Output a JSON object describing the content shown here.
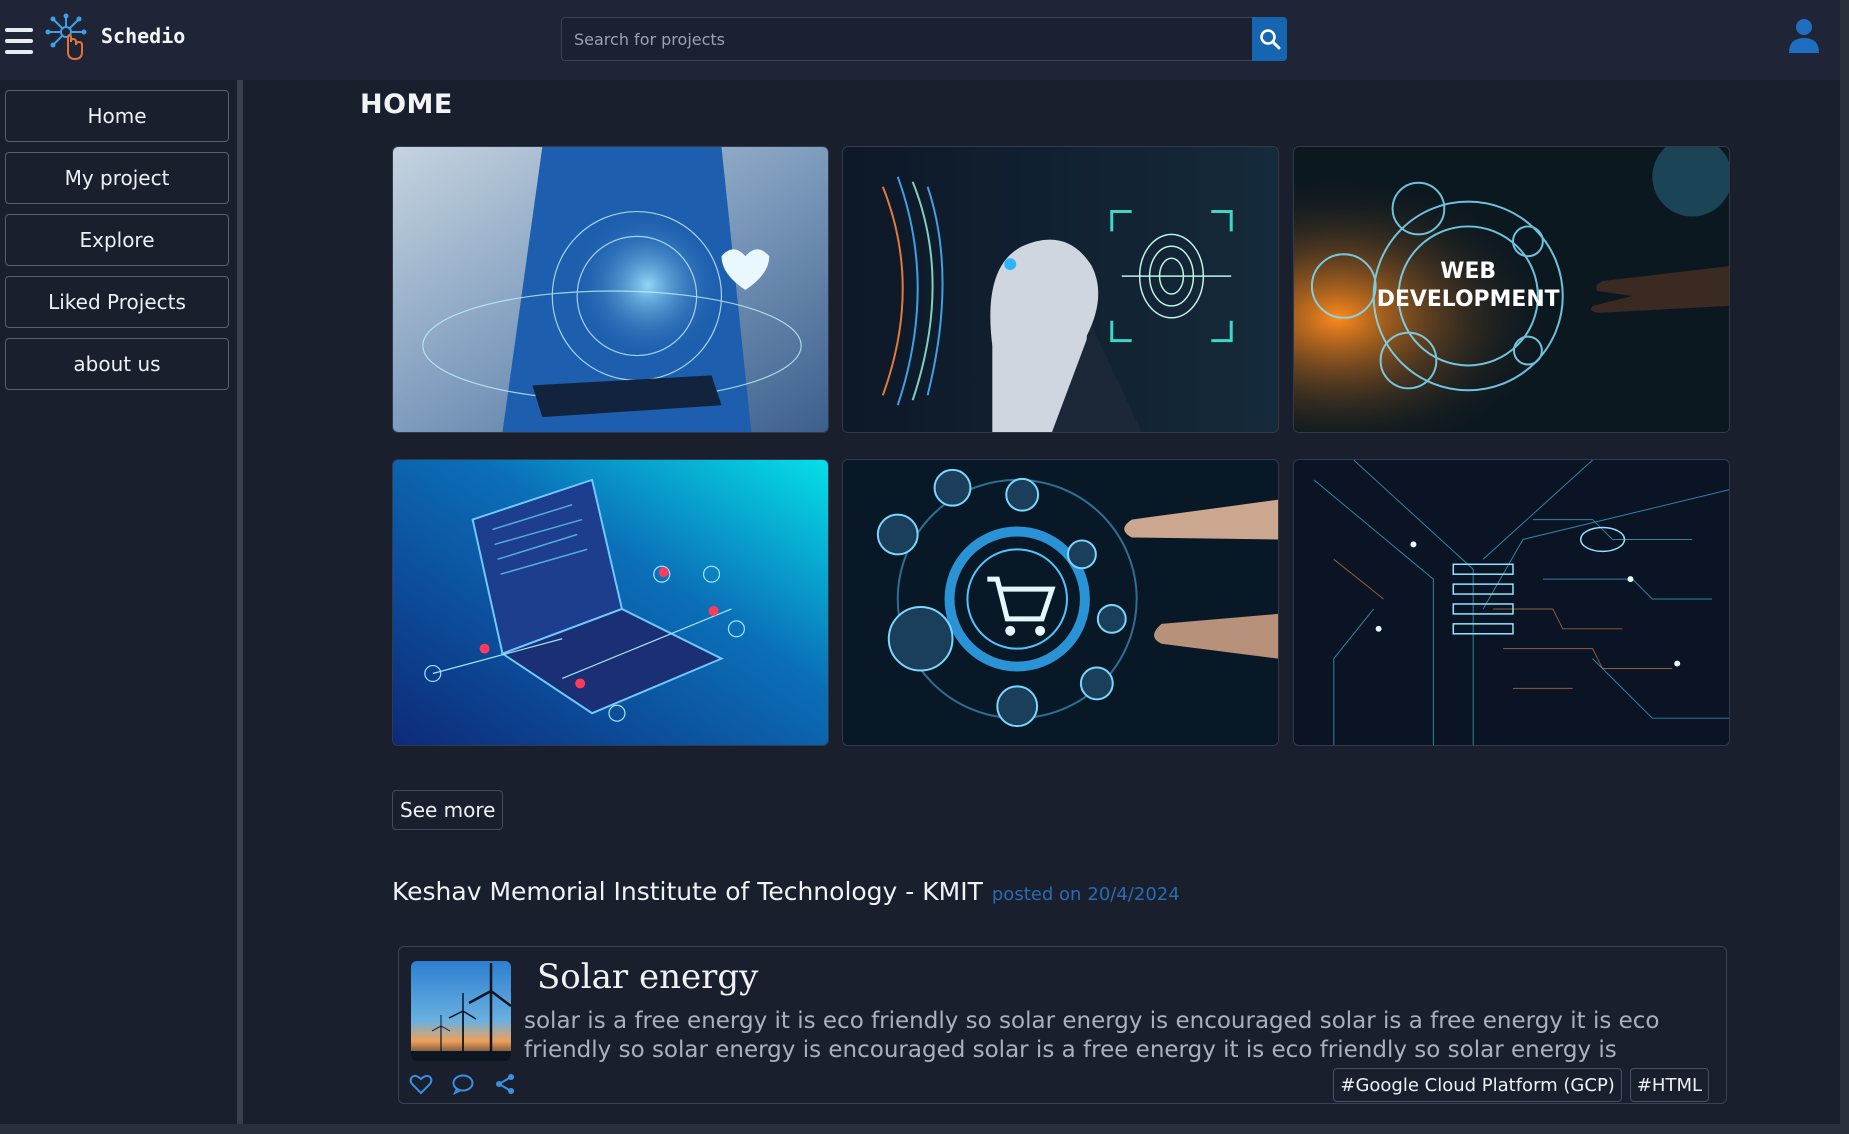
{
  "app": {
    "brand": "Schedio"
  },
  "search": {
    "placeholder": "Search for projects"
  },
  "sidebar": {
    "items": [
      {
        "label": "Home"
      },
      {
        "label": "My project"
      },
      {
        "label": "Explore"
      },
      {
        "label": "Liked Projects"
      },
      {
        "label": "about us"
      }
    ]
  },
  "main": {
    "title": "HOME",
    "tiles": [
      {
        "icon": "medical-tech-image"
      },
      {
        "icon": "ai-robot-fingerprint-image"
      },
      {
        "icon": "web-development-image"
      },
      {
        "icon": "laptop-network-image"
      },
      {
        "icon": "ecommerce-cart-image"
      },
      {
        "icon": "circuit-board-image"
      }
    ],
    "see_more_label": "See more"
  },
  "post": {
    "org": "Keshav Memorial Institute of Technology - KMIT",
    "posted_on_label": "posted on",
    "date": "20/4/2024",
    "card": {
      "title": "Solar energy",
      "description": "solar is a free energy it is eco friendly so solar energy is encouraged solar is a free energy it is eco friendly so solar energy is encouraged solar is a free energy it is eco friendly so solar energy is encouraged",
      "tags": [
        "#Google Cloud Platform (GCP)",
        "#HTML"
      ],
      "actions": [
        "heart-icon",
        "comment-icon",
        "share-icon"
      ]
    }
  },
  "colors": {
    "background": "#1a1f2e",
    "topbar": "#1f2536",
    "accent": "#1565b0",
    "meta_text": "#2b6bb1"
  }
}
